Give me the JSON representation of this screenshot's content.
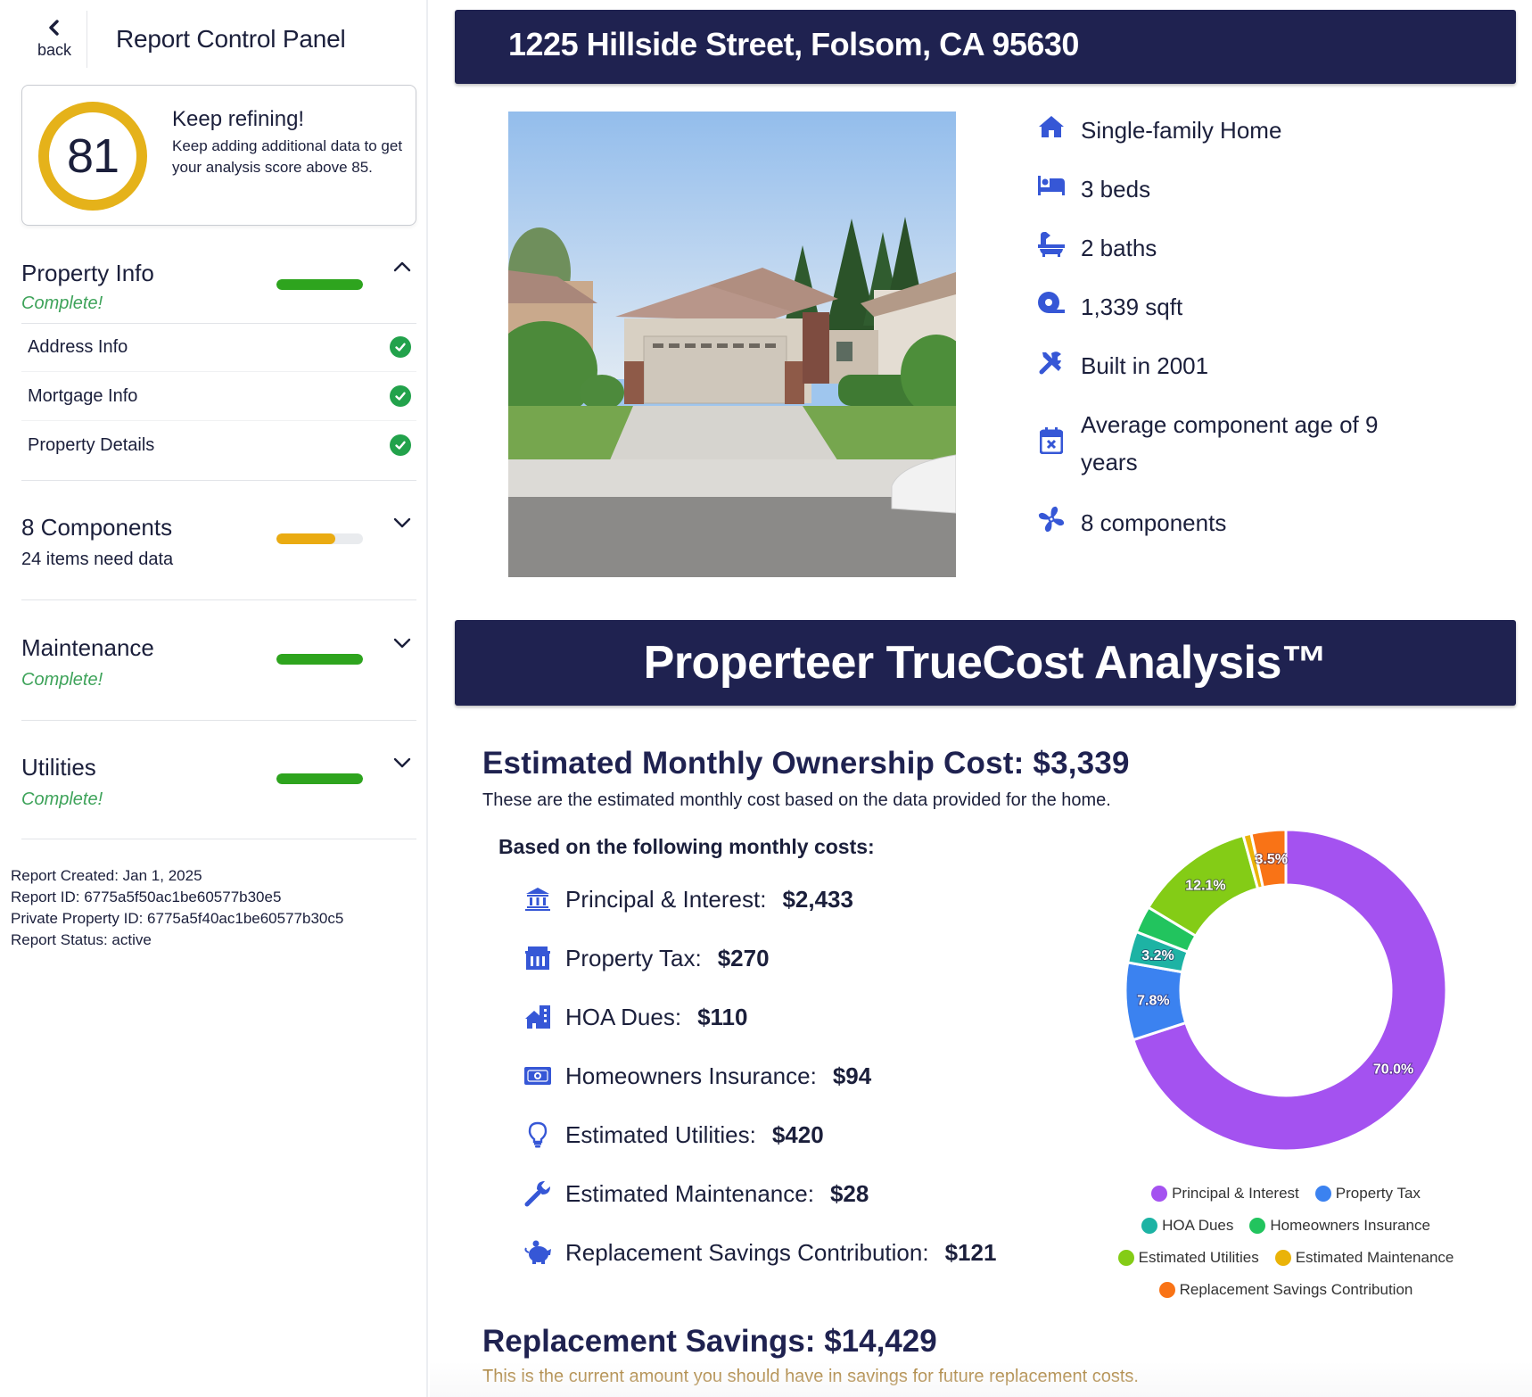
{
  "sidebar": {
    "back_label": "back",
    "title": "Report Control Panel",
    "score": {
      "value": "81",
      "heading": "Keep refining!",
      "description": "Keep adding additional data to get your analysis score above 85.",
      "ring_color": "#e5b21a"
    },
    "sections": [
      {
        "title": "Property Info",
        "status": "Complete!",
        "progress": 1.0,
        "progress_color": "#2ea41e",
        "expanded": true,
        "items": [
          {
            "label": "Address Info",
            "complete": true
          },
          {
            "label": "Mortgage Info",
            "complete": true
          },
          {
            "label": "Property Details",
            "complete": true
          }
        ]
      },
      {
        "title": "8 Components",
        "status": "24 items need data",
        "progress": 0.68,
        "progress_color": "#eaab12",
        "expanded": false
      },
      {
        "title": "Maintenance",
        "status": "Complete!",
        "progress": 1.0,
        "progress_color": "#2ea41e",
        "expanded": false
      },
      {
        "title": "Utilities",
        "status": "Complete!",
        "progress": 1.0,
        "progress_color": "#2ea41e",
        "expanded": false
      }
    ],
    "meta": {
      "created": "Report Created: Jan 1, 2025",
      "report_id": "Report ID: 6775a5f50ac1be60577b30e5",
      "property_id": "Private Property ID: 6775a5f40ac1be60577b30c5",
      "status": "Report Status: active"
    }
  },
  "property": {
    "address": "1225 Hillside Street, Folsom, CA 95630",
    "facts": [
      {
        "icon": "house-icon",
        "text": "Single-family Home"
      },
      {
        "icon": "bed-icon",
        "text": "3 beds"
      },
      {
        "icon": "bath-icon",
        "text": "2 baths"
      },
      {
        "icon": "tape-measure-icon",
        "text": "1,339 sqft"
      },
      {
        "icon": "tools-icon",
        "text": "Built in 2001"
      },
      {
        "icon": "calendar-x-icon",
        "text": "Average component age of 9 years"
      },
      {
        "icon": "fan-icon",
        "text": "8 components"
      }
    ]
  },
  "analysis": {
    "banner": "Properteer TrueCost Analysis™",
    "monthly_title": "Estimated Monthly Ownership Cost: $3,339",
    "monthly_desc": "These are the estimated monthly cost based on the data provided for the home.",
    "based_on": "Based on the following monthly costs:",
    "costs": [
      {
        "icon": "bank-icon",
        "label": "Principal & Interest:",
        "value": "$2,433"
      },
      {
        "icon": "government-building-icon",
        "label": "Property Tax:",
        "value": "$270"
      },
      {
        "icon": "hoa-building-icon",
        "label": "HOA Dues:",
        "value": "$110"
      },
      {
        "icon": "money-bill-icon",
        "label": "Homeowners Insurance:",
        "value": "$94"
      },
      {
        "icon": "lightbulb-icon",
        "label": "Estimated Utilities:",
        "value": "$420"
      },
      {
        "icon": "wrench-icon",
        "label": "Estimated Maintenance:",
        "value": "$28"
      },
      {
        "icon": "piggy-bank-icon",
        "label": "Replacement Savings Contribution:",
        "value": "$121"
      }
    ],
    "replacement_title": "Replacement Savings: $14,429",
    "replacement_desc": "This is the current amount you should have in savings for future replacement costs.",
    "accent_color": "#3657d6"
  },
  "chart_data": {
    "type": "pie",
    "variant": "donut",
    "title": "",
    "start": "top, clockwise",
    "legend_position": "bottom",
    "categories": [
      "Principal & Interest",
      "Property Tax",
      "HOA Dues",
      "Homeowners Insurance",
      "Estimated Utilities",
      "Estimated Maintenance",
      "Replacement Savings Contribution"
    ],
    "values": [
      2433,
      270,
      110,
      94,
      420,
      28,
      121
    ],
    "percent_labels": [
      "70.0%",
      "7.8%",
      "3.2%",
      "",
      "12.1%",
      "",
      "3.5%"
    ],
    "colors": [
      "#a452f0",
      "#3b82f0",
      "#1db3a4",
      "#22c45e",
      "#84cc16",
      "#eab308",
      "#f97316"
    ]
  }
}
